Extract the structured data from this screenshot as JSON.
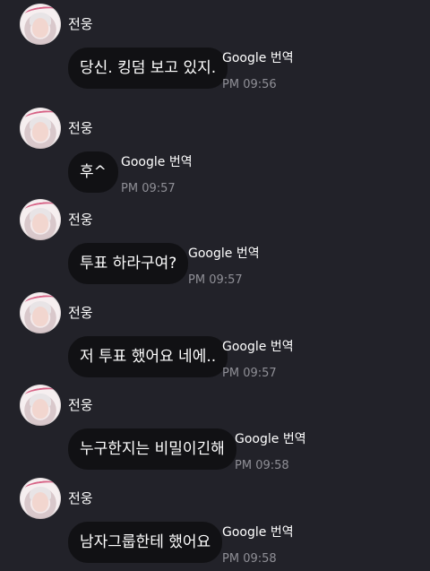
{
  "messages": [
    {
      "sender": "전웅",
      "text": "당신. 킹덤 보고 있지.",
      "translate": "Google 번역",
      "time": "PM 09:56"
    },
    {
      "sender": "전웅",
      "text": "후^",
      "translate": "Google 번역",
      "time": "PM 09:57"
    },
    {
      "sender": "전웅",
      "text": "투표 하라구여?",
      "translate": "Google 번역",
      "time": "PM 09:57"
    },
    {
      "sender": "전웅",
      "text": "저 투표 했어요 네에..",
      "translate": "Google 번역",
      "time": "PM 09:57"
    },
    {
      "sender": "전웅",
      "text": "누구한지는 비밀이긴해",
      "translate": "Google 번역",
      "time": "PM 09:58"
    },
    {
      "sender": "전웅",
      "text": "남자그룹한테 했어요",
      "translate": "Google 번역",
      "time": "PM 09:58"
    }
  ]
}
